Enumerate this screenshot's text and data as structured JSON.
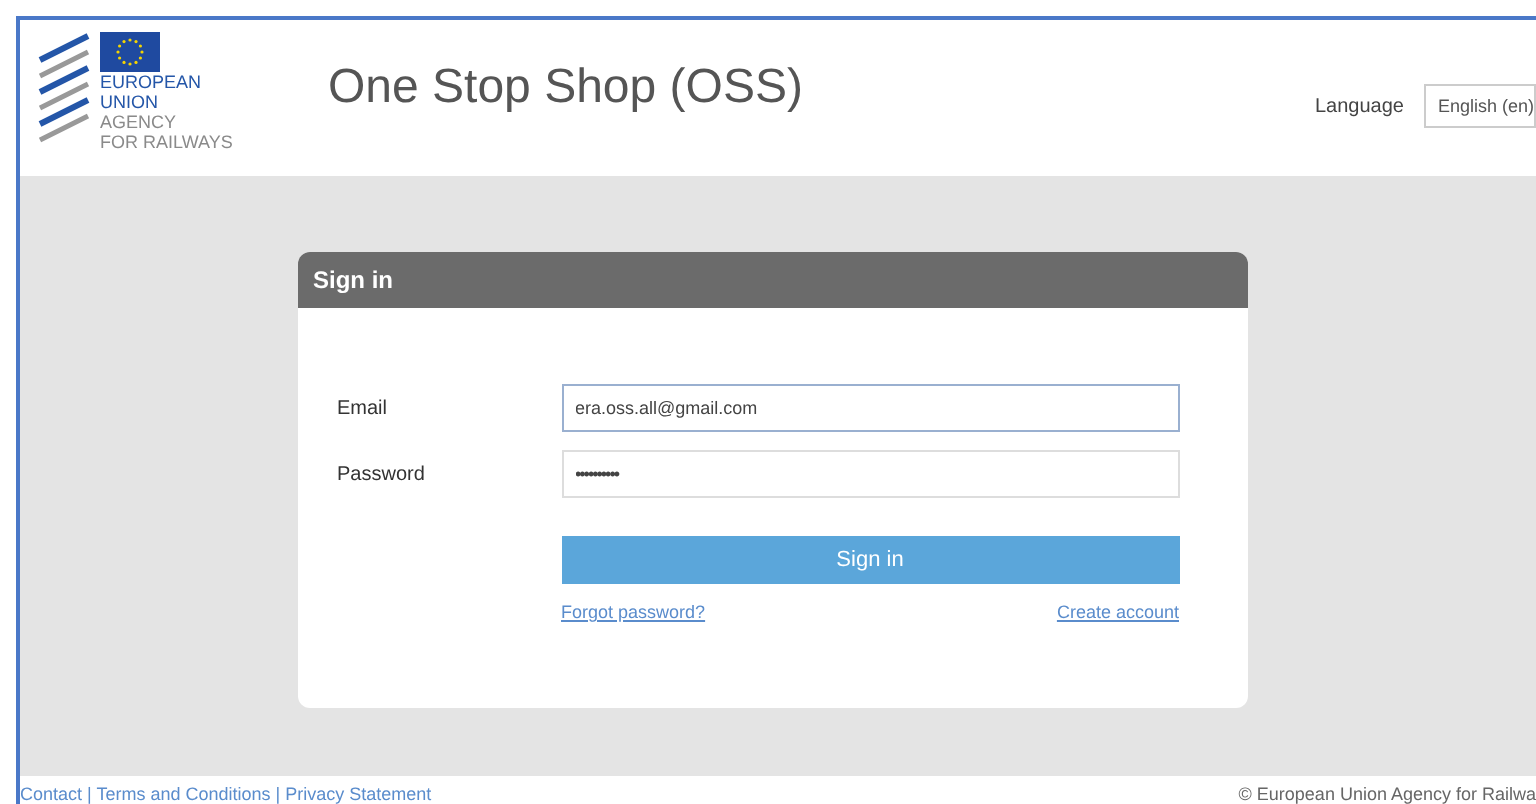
{
  "logo": {
    "lines": [
      "EUROPEAN",
      "UNION",
      "AGENCY",
      "FOR RAILWAYS"
    ]
  },
  "header": {
    "title": "One Stop Shop (OSS)",
    "language_label": "Language",
    "language_value": "English (en)"
  },
  "signin": {
    "title": "Sign in",
    "fields": [
      {
        "label": "Email",
        "value": "era.oss.all@gmail.com",
        "kind": "text",
        "focused": true
      },
      {
        "label": "Password",
        "value": "••••••••••",
        "kind": "password",
        "focused": false
      }
    ],
    "button": "Sign in",
    "links": [
      "Forgot password?",
      "Create account"
    ]
  },
  "footer": {
    "links": "Contact | Terms and Conditions | Privacy Statement",
    "copyright": "© European Union Agency for Railwa"
  }
}
